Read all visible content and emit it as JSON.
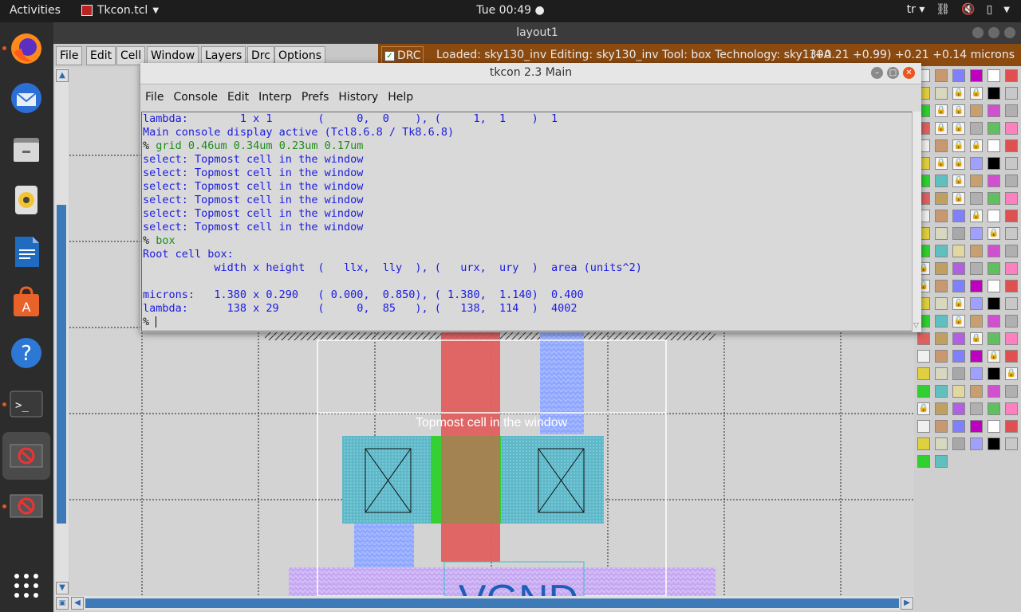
{
  "topbar": {
    "activities": "Activities",
    "app_name": "Tkcon.tcl",
    "clock": "Tue 00:49",
    "keyboard_layout": "tr"
  },
  "dock": {
    "items": [
      "firefox-icon",
      "thunderbird-icon",
      "files-icon",
      "rhythmbox-icon",
      "writer-icon",
      "software-icon",
      "help-icon",
      "terminal-icon",
      "magic-icon",
      "magic-icon-2",
      "apps-grid-icon"
    ]
  },
  "main_window": {
    "title": "layout1",
    "menu": [
      "File",
      "Edit",
      "Cell",
      "Window",
      "Layers",
      "Drc",
      "Options"
    ],
    "drc_label": "DRC",
    "status": "Loaded: sky130_inv Editing: sky130_inv Tool: box  Technology: sky130A",
    "coords": "(+0.21 +0.99) +0.21 +0.14 microns",
    "canvas_label": "Topmost cell in the window",
    "canvas_bottom_label": "VGND"
  },
  "tkcon": {
    "title": "tkcon 2.3 Main",
    "menu": [
      "File",
      "Console",
      "Edit",
      "Interp",
      "Prefs",
      "History",
      "Help"
    ],
    "lines": [
      {
        "type": "out",
        "text": "lambda:        1 x 1       (     0,  0    ), (     1,  1    )  1"
      },
      {
        "type": "out",
        "text": "Main console display active (Tcl8.6.8 / Tk8.6.8)"
      },
      {
        "type": "cmd",
        "prompt": "% ",
        "text": "grid 0.46um 0.34um 0.23um 0.17um"
      },
      {
        "type": "out",
        "text": "select: Topmost cell in the window"
      },
      {
        "type": "out",
        "text": "select: Topmost cell in the window"
      },
      {
        "type": "out",
        "text": "select: Topmost cell in the window"
      },
      {
        "type": "out",
        "text": "select: Topmost cell in the window"
      },
      {
        "type": "out",
        "text": "select: Topmost cell in the window"
      },
      {
        "type": "out",
        "text": "select: Topmost cell in the window"
      },
      {
        "type": "cmd",
        "prompt": "% ",
        "text": "box"
      },
      {
        "type": "out",
        "text": "Root cell box:"
      },
      {
        "type": "out",
        "text": "           width x height  (   llx,  lly  ), (   urx,  ury  )  area (units^2)"
      },
      {
        "type": "out",
        "text": ""
      },
      {
        "type": "out",
        "text": "microns:   1.380 x 0.290   ( 0.000,  0.850), ( 1.380,  1.140)  0.400"
      },
      {
        "type": "out",
        "text": "lambda:      138 x 29      (     0,  85   ), (   138,  114  )  4002"
      },
      {
        "type": "cmd",
        "prompt": "% ",
        "text": ""
      }
    ]
  }
}
